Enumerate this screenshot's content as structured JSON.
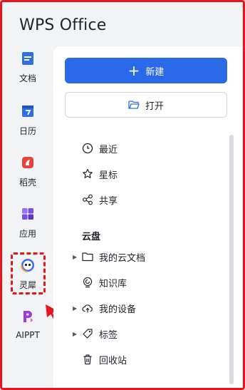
{
  "app": {
    "title": "WPS Office"
  },
  "rail": {
    "items": [
      {
        "label": "文档",
        "icon": "document-icon",
        "color": "#2f6fe4"
      },
      {
        "label": "日历",
        "icon": "calendar-icon",
        "color": "#2f6fe4"
      },
      {
        "label": "稻壳",
        "icon": "daoke-icon",
        "color": "#e8433b"
      },
      {
        "label": "应用",
        "icon": "apps-icon",
        "color": "#7a4ee0"
      },
      {
        "label": "灵犀",
        "icon": "lingxi-icon",
        "color": "#3b6cf0",
        "highlighted": true
      },
      {
        "label": "AIPPT",
        "icon": "aippt-icon",
        "color": "#9b3cd6"
      }
    ]
  },
  "actions": {
    "new_label": "新建",
    "open_label": "打开"
  },
  "nav": {
    "recent": "最近",
    "starred": "星标",
    "shared": "共享",
    "cloud_section": "云盘",
    "cloud_docs": "我的云文档",
    "knowledge": "知识库",
    "devices": "我的设备",
    "tags": "标签",
    "recycle": "回收站"
  },
  "colors": {
    "accent": "#2a6ae8",
    "highlight": "#e8161c"
  }
}
